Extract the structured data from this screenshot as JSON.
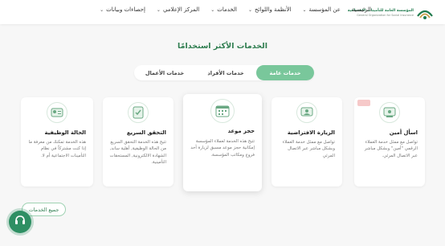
{
  "logo": {
    "arabic": "المؤسسة العامة للتأمينات الاجتماعية",
    "english": "General Organization for Social Insurance",
    "brand_color": "#1f7a4d"
  },
  "nav": [
    {
      "label": "الرئيسية",
      "has_dropdown": false
    },
    {
      "label": "عن المؤسسة",
      "has_dropdown": true
    },
    {
      "label": "الأنظمة واللوائح",
      "has_dropdown": true
    },
    {
      "label": "الخدمات",
      "has_dropdown": true
    },
    {
      "label": "المركز الإعلامي",
      "has_dropdown": true
    },
    {
      "label": "إحصاءات وبيانات",
      "has_dropdown": true
    }
  ],
  "section": {
    "title": "الخدمات الأكثر استخدامًا"
  },
  "tabs": [
    {
      "label": "خدمات عامة",
      "active": true
    },
    {
      "label": "خدمات الأفراد",
      "active": false
    },
    {
      "label": "خدمات الأعمال",
      "active": false
    }
  ],
  "cards": [
    {
      "title": "اسأل أمين",
      "desc": "تواصل مع ممثل خدمة العملاء الرقمي \"أمين\" وبشكل مباشر عبر الاتصال المرئي.",
      "icon": "chat-icon"
    },
    {
      "title": "الزيارة الافتراضية",
      "desc": "تواصل مع ممثل خدمة العملاء وبشكل مباشر عبر الاتصال المرئي",
      "icon": "video-call-icon"
    },
    {
      "title": "حجز موعد",
      "desc": "تتيح هذه الخدمة لعملاء المؤسسة إمكانية حجز موعد مسبق لزيارة أحد فروع ومكاتب المؤسسة.",
      "icon": "calendar-icon"
    },
    {
      "title": "التحقق السريع",
      "desc": "تتيح هذه الخدمة التحقق السريع من الحالة الوظيفية, أهلية ساند, الشهادة الالكترونية, المستحقات التأمينية.",
      "icon": "checklist-icon"
    },
    {
      "title": "الحالة الوظيفية",
      "desc": "هذه الخدمة تمكنك من معرفة ما إذا كنت مشتركاً في نظام التأمينات الاجتماعية أم لا.",
      "icon": "id-card-icon"
    }
  ],
  "all_services_label": "جميع الخدمات",
  "colors": {
    "accent": "#79c79b",
    "accent_dark": "#2e7d4f",
    "support_button": "#2e8f63"
  }
}
